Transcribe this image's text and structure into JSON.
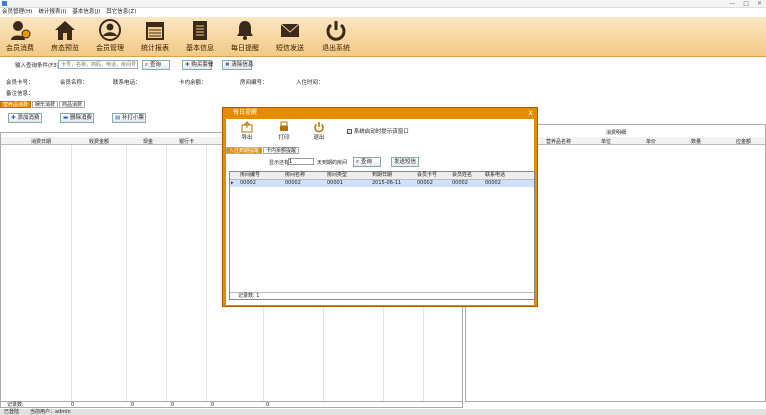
{
  "window": {
    "minimize": "—",
    "maximize": "□",
    "close": "✕"
  },
  "menu": [
    "会员管理(H)",
    "统计报表(I)",
    "基本信息(J)",
    "其它信息(Z)"
  ],
  "toolbar": [
    {
      "label": "会员消费",
      "icon": "member-consume-icon"
    },
    {
      "label": "房态预览",
      "icon": "house-icon"
    },
    {
      "label": "会员管理",
      "icon": "user-circle-icon"
    },
    {
      "label": "统计报表",
      "icon": "calendar-icon"
    },
    {
      "label": "基本信息",
      "icon": "book-icon"
    },
    {
      "label": "每日提醒",
      "icon": "bell-icon"
    },
    {
      "label": "短信发送",
      "icon": "envelope-icon"
    },
    {
      "label": "退出系统",
      "icon": "power-icon"
    }
  ],
  "search": {
    "label": "输入查询条件(F3):",
    "placeholder": "卡号，名称，简码，电话，房间号",
    "query": "查询",
    "buy": "购买套餐",
    "clear": "清除信息"
  },
  "info": {
    "card": "会员卡号：",
    "name": "会员名称：",
    "phone": "联系电话：",
    "balance": "卡内余额：",
    "room": "房间编号：",
    "checkin": "入住时间：",
    "note": "备注信息："
  },
  "tabs": [
    "营养品消费",
    "娱乐消费",
    "商品消费"
  ],
  "actions": {
    "add": "添加消费",
    "del": "删除消费",
    "print": "补打小票"
  },
  "leftgrid": {
    "headers": [
      "消费日期",
      "收费金额",
      "现金",
      "银行卡"
    ]
  },
  "rightgrid": {
    "title": "消费明细",
    "headers": [
      "营养品名称",
      "单位",
      "单价",
      "数量",
      "应金额"
    ]
  },
  "status": {
    "left": "记录数:",
    "zeros": [
      "0",
      "0",
      "0",
      "0",
      "0"
    ]
  },
  "bottom": {
    "a": "已登陆",
    "b": "当前用户：admin"
  },
  "dialog": {
    "title": "每日提醒",
    "tools": [
      "导出",
      "打印",
      "退出"
    ],
    "checkbox": "系统启动时提示该窗口",
    "tabs": [
      "入住到期提醒",
      "卡内余额提醒"
    ],
    "filter": {
      "prefix": "显示还有",
      "value": "1",
      "suffix": "天到期的房间",
      "query": "查询",
      "sms": "发送短信"
    },
    "headers": [
      "房间编号",
      "房间名称",
      "房间类型",
      "到期日期",
      "会员卡号",
      "会员姓名",
      "联系电话"
    ],
    "row": [
      "00002",
      "00002",
      "00001",
      "2015-06-11",
      "00002",
      "00002",
      "00002"
    ],
    "footer": "记录数: 1"
  }
}
